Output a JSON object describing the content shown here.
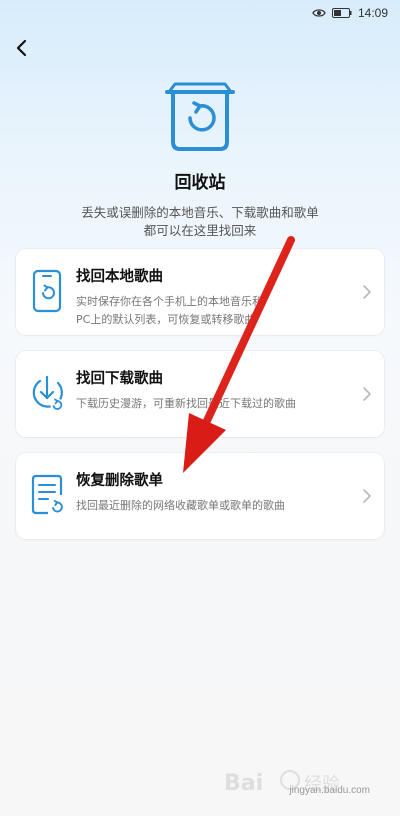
{
  "status_bar": {
    "time": "14:09",
    "icons": [
      "eye-icon",
      "battery-icon"
    ]
  },
  "header": {
    "back_icon": "chevron-left-icon"
  },
  "hero": {
    "icon": "recycle-bin-icon",
    "title": "回收站",
    "subtitle_line1": "丢失或误删除的本地音乐、下载歌曲和歌单",
    "subtitle_line2": "都可以在这里找回来"
  },
  "cards": [
    {
      "title": "找回本地歌曲",
      "desc_line1": "实时保存你在各个手机上的本地音乐和",
      "desc_line2": "PC上的默认列表，可恢复或转移歌曲",
      "icon": "phone-restore-icon"
    },
    {
      "title": "找回下载歌曲",
      "desc_line1": "下载历史漫游，可重新找回最近下载过的歌曲",
      "icon": "download-restore-icon"
    },
    {
      "title": "恢复删除歌单",
      "desc_line1": "找回最近删除的网络收藏歌单或歌单的歌曲",
      "icon": "playlist-restore-icon"
    }
  ],
  "colors": {
    "accent": "#2b8fd6",
    "annotation_arrow": "#e3241b",
    "chevron": "#b8b8b8"
  },
  "watermark": {
    "text": "jingyan.baidu.com"
  }
}
